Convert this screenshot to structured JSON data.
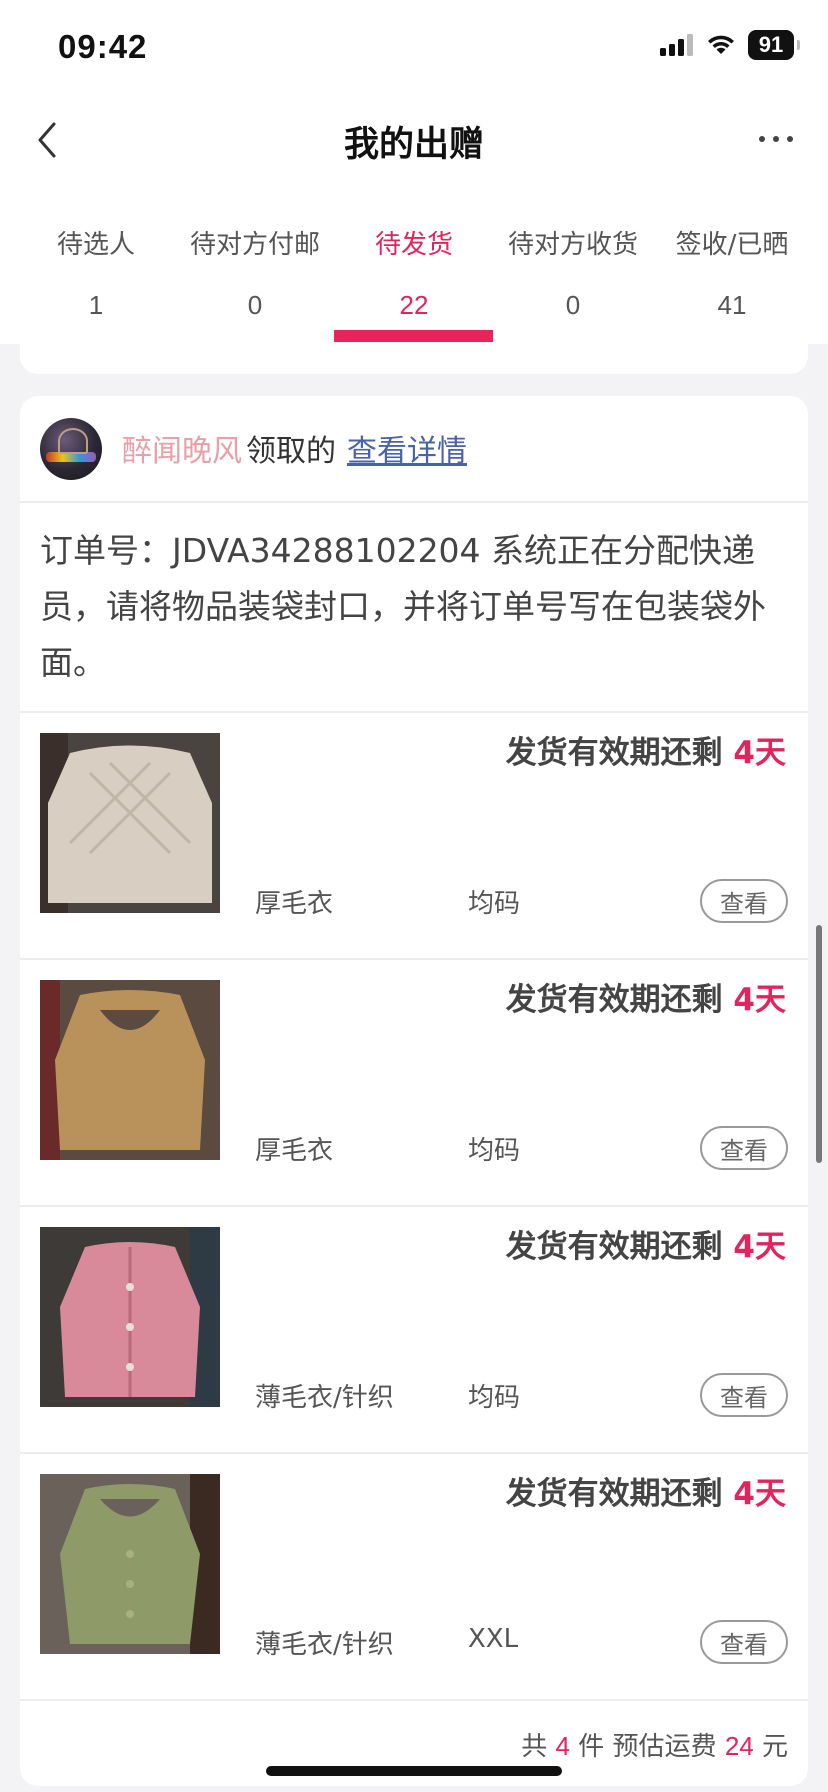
{
  "status_bar": {
    "time": "09:42",
    "battery": "91"
  },
  "nav": {
    "title": "我的出赠"
  },
  "tabs": [
    {
      "label": "待选人",
      "count": "1",
      "active": false
    },
    {
      "label": "待对方付邮",
      "count": "0",
      "active": false
    },
    {
      "label": "待发货",
      "count": "22",
      "active": true
    },
    {
      "label": "待对方收货",
      "count": "0",
      "active": false
    },
    {
      "label": "签收/已晒",
      "count": "41",
      "active": false
    }
  ],
  "card": {
    "receiver_name": "醉闻晚风",
    "claimed_text": "领取的",
    "details_link": "查看详情",
    "order_note": "订单号：JDVA34288102204 系统正在分配快递员，请将物品装袋封口，并将订单号写在包装袋外面。",
    "items": [
      {
        "deadline_prefix": "发货有效期还剩 ",
        "days": "4天",
        "category": "厚毛衣",
        "size": "均码",
        "view": "查看",
        "thumb_color": "#d8cfc2",
        "bg_color": "#4a4440"
      },
      {
        "deadline_prefix": "发货有效期还剩 ",
        "days": "4天",
        "category": "厚毛衣",
        "size": "均码",
        "view": "查看",
        "thumb_color": "#b8925a",
        "bg_color": "#5a4a40"
      },
      {
        "deadline_prefix": "发货有效期还剩 ",
        "days": "4天",
        "category": "薄毛衣/针织",
        "size": "均码",
        "view": "查看",
        "thumb_color": "#d88a9a",
        "bg_color": "#3e3a38"
      },
      {
        "deadline_prefix": "发货有效期还剩 ",
        "days": "4天",
        "category": "薄毛衣/针织",
        "size": "XXL",
        "view": "查看",
        "thumb_color": "#8e9a68",
        "bg_color": "#6a625a"
      }
    ],
    "summary": {
      "prefix": "共 ",
      "count": "4",
      "middle": " 件 预估运费 ",
      "fee": "24",
      "suffix": " 元"
    }
  },
  "colors": {
    "accent": "#e8245a",
    "link": "#4a63a8",
    "name": "#e8a0a8"
  }
}
